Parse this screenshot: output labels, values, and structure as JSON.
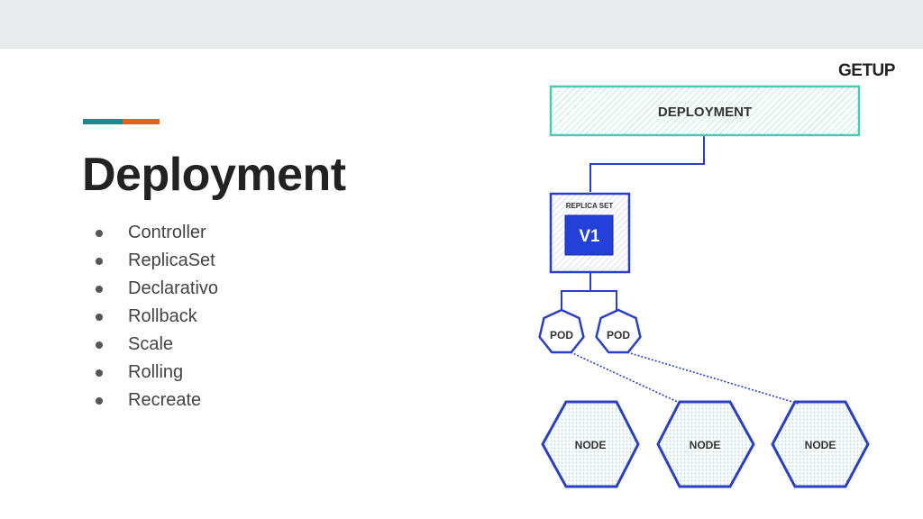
{
  "slide": {
    "title": "Deployment",
    "bullets": [
      "Controller",
      "ReplicaSet",
      "Declarativo",
      "Rollback",
      "Scale",
      "Rolling",
      "Recreate"
    ]
  },
  "logo": {
    "text": "GETUP"
  },
  "diagram": {
    "deployment_label": "DEPLOYMENT",
    "replicaset_label": "REPLICA SET",
    "version_label": "V1",
    "pods": [
      "POD",
      "POD"
    ],
    "nodes": [
      "NODE",
      "NODE",
      "NODE"
    ]
  },
  "colors": {
    "accent_teal": "#1f8a8a",
    "accent_orange": "#e0621c",
    "deployment_border": "#4cc9b0",
    "diagram_blue": "#2b3fc4",
    "topbar": "#e8eaeb"
  }
}
